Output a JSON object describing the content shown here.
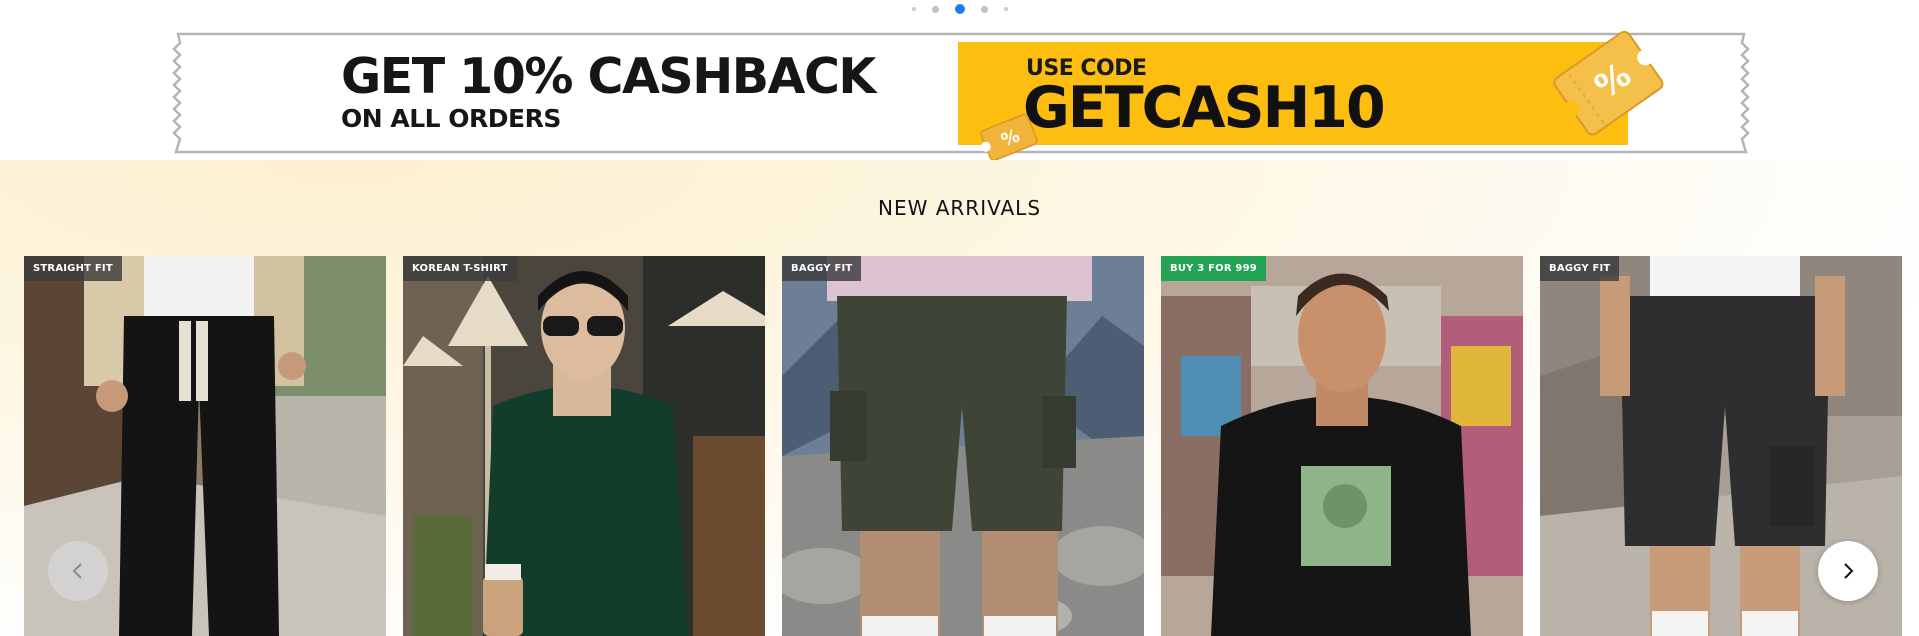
{
  "carousel": {
    "slide_count": 5,
    "active_index": 2
  },
  "banner": {
    "headline": "GET 10% CASHBACK",
    "subline": "ON ALL ORDERS",
    "code_label": "USE CODE",
    "code_value": "GETCASH10",
    "ticket_symbol": "%",
    "accent_color": "#fdbe0f"
  },
  "section": {
    "title": "NEW ARRIVALS"
  },
  "products": [
    {
      "badge": "STRAIGHT FIT",
      "badge_color": "#3c3c3c"
    },
    {
      "badge": "KOREAN T-SHIRT",
      "badge_color": "#3c3c3c"
    },
    {
      "badge": "BAGGY FIT",
      "badge_color": "#3c3c3c"
    },
    {
      "badge": "BUY 3 FOR 999",
      "badge_color": "#23a455"
    },
    {
      "badge": "BAGGY FIT",
      "badge_color": "#3c3c3c"
    }
  ],
  "navigation": {
    "prev_icon": "chevron-left-icon",
    "next_icon": "chevron-right-icon"
  }
}
